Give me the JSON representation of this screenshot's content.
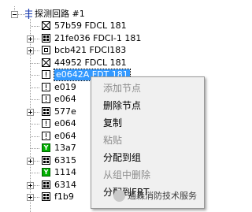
{
  "tree": {
    "root_label": "探测回路 #1",
    "items": [
      {
        "label": "57b59 FDCL 181",
        "icon": "x-box-icon"
      },
      {
        "label": "21fe036 FDCI-1 181",
        "icon": "grid-icon"
      },
      {
        "label": "bcb421 FDCI183",
        "icon": "square-icon"
      },
      {
        "label": "44952 FDCL 181",
        "icon": "x-box-icon"
      },
      {
        "label": "e0642A FDT 181",
        "icon": "exclamation-icon"
      },
      {
        "label": "e019",
        "icon": "exclamation-icon"
      },
      {
        "label": "e064",
        "icon": "exclamation-icon"
      },
      {
        "label": "577e",
        "icon": "grid-icon"
      },
      {
        "label": "e064",
        "icon": "exclamation-icon"
      },
      {
        "label": "e064",
        "icon": "exclamation-icon"
      },
      {
        "label": "13a7",
        "icon": "y-icon"
      },
      {
        "label": "6315",
        "icon": "grid-icon"
      },
      {
        "label": "1114",
        "icon": "y-icon"
      },
      {
        "label": "6314",
        "icon": "grid-icon"
      },
      {
        "label": "f1b9",
        "icon": "grid-icon"
      }
    ],
    "y_icon_letter": "Y"
  },
  "context_menu": {
    "items": [
      {
        "label": "添加节点",
        "enabled": false
      },
      {
        "label": "删除节点",
        "enabled": true
      },
      {
        "label": "复制",
        "enabled": true
      },
      {
        "label": "粘贴",
        "enabled": false
      },
      {
        "label": "分配到组",
        "enabled": true
      },
      {
        "label": "从组中删除",
        "enabled": false
      },
      {
        "label": "分配到FBT",
        "enabled": true
      }
    ]
  },
  "watermark": {
    "text": "通森消防技术服务"
  },
  "colors": {
    "selection": "#3399ff",
    "menu_background": "#f0f0f0",
    "disabled_text": "#8d8d8d",
    "y_icon": "#00b000"
  }
}
